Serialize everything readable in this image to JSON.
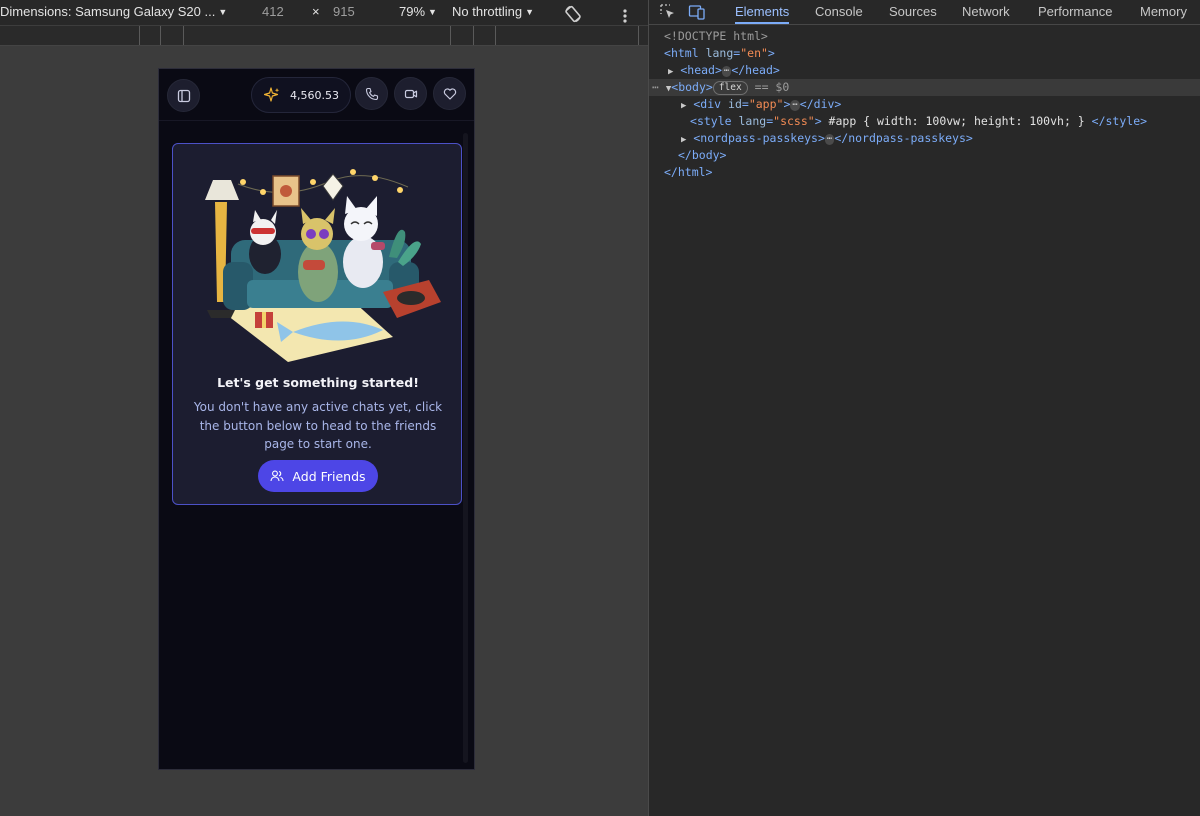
{
  "device_toolbar": {
    "device": "Dimensions: Samsung Galaxy S20 ...",
    "width": "412",
    "times": "×",
    "height": "915",
    "zoom": "79%",
    "throttling": "No throttling"
  },
  "app": {
    "credits": "4,560.53",
    "empty_title": "Let's get something started!",
    "empty_desc": "You don't have any active chats yet, click the button below to head to the friends page to start one.",
    "add_button": "Add Friends",
    "accent": "#4d46e6"
  },
  "devtools": {
    "tabs": [
      "Elements",
      "Console",
      "Sources",
      "Network",
      "Performance",
      "Memory"
    ],
    "active_tab": "Elements",
    "doctype": "<!DOCTYPE html>",
    "html_tag": "html",
    "html_lang_attr": "lang",
    "html_lang_val": "\"en\"",
    "head_open": "<head>",
    "head_close": "</head>",
    "body_open": "<body>",
    "body_badge": "flex",
    "body_selected": "== $0",
    "div_tag": "div",
    "div_attr": "id",
    "div_val": "\"app\"",
    "div_close": "</div>",
    "style_tag": "style",
    "style_attr": "lang",
    "style_val": "\"scss\"",
    "style_content": " #app { width: 100vw; height: 100vh; } ",
    "style_close": "</style>",
    "nordpass_open": "<nordpass-passkeys>",
    "nordpass_close": "</nordpass-passkeys>",
    "body_close": "</body>",
    "html_close": "</html>"
  }
}
